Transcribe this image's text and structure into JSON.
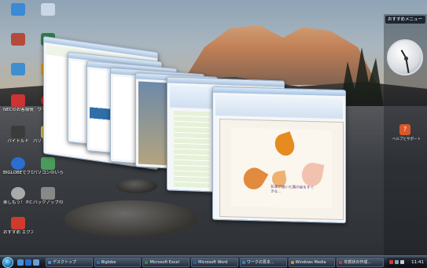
{
  "desktop": {
    "icons": [
      {
        "label": "",
        "color": "#3a8ad6"
      },
      {
        "label": "",
        "color": "#c9d7e6"
      },
      {
        "label": "",
        "color": "#b44a3a"
      },
      {
        "label": "",
        "color": "#2f7d4a"
      },
      {
        "label": "",
        "color": "#3f8fd0"
      },
      {
        "label": "",
        "color": "#e0a020"
      },
      {
        "label": "NECのお客様情報",
        "color": "#c33"
      },
      {
        "label": "ウイルス...",
        "color": "#cc2a2a"
      },
      {
        "label": "バイトルド",
        "color": "#3b3b3b"
      },
      {
        "label": "パソコンのいろは Office入...",
        "color": "#d9c04a"
      },
      {
        "label": "BIGLOBEでブロードバンド",
        "color": "#2a6fcf"
      },
      {
        "label": "パソコンのいろは",
        "color": "#4a9c5a"
      },
      {
        "label": "楽しもう！ P.C. ライフ",
        "color": "#aaa"
      },
      {
        "label": "バックアップのご案内",
        "color": "#888"
      },
      {
        "label": "おすすめ エクスプローラ",
        "color": "#cf3b2a"
      }
    ]
  },
  "flip3d": {
    "windows": [
      {
        "title": "",
        "kind": "browser"
      },
      {
        "title": "",
        "kind": "explorer"
      },
      {
        "title": "",
        "kind": "web"
      },
      {
        "title": "",
        "kind": "media"
      },
      {
        "title": "",
        "kind": "photo"
      },
      {
        "title": "",
        "kind": "excel"
      },
      {
        "title": "",
        "kind": "word"
      }
    ],
    "document_note": "友達が描いた葉の絵をすてきな..."
  },
  "sidebar": {
    "header": "おすすめメニュー",
    "sub": "",
    "help_label": "ヘルプとサポート"
  },
  "taskbar": {
    "tasks": [
      {
        "label": "デスクトップ",
        "color": "#4a90d9"
      },
      {
        "label": "Biglobe",
        "color": "#2a6fcf"
      },
      {
        "label": "Microsoft Excel",
        "color": "#2f8b3a"
      },
      {
        "label": "Microsoft Word",
        "color": "#2b5aa8"
      },
      {
        "label": "ワークの見本...",
        "color": "#3a7fc1"
      },
      {
        "label": "Windows Media",
        "color": "#e08b1f"
      },
      {
        "label": "年賀状の作成...",
        "color": "#c33"
      }
    ],
    "clock": "11:41"
  }
}
